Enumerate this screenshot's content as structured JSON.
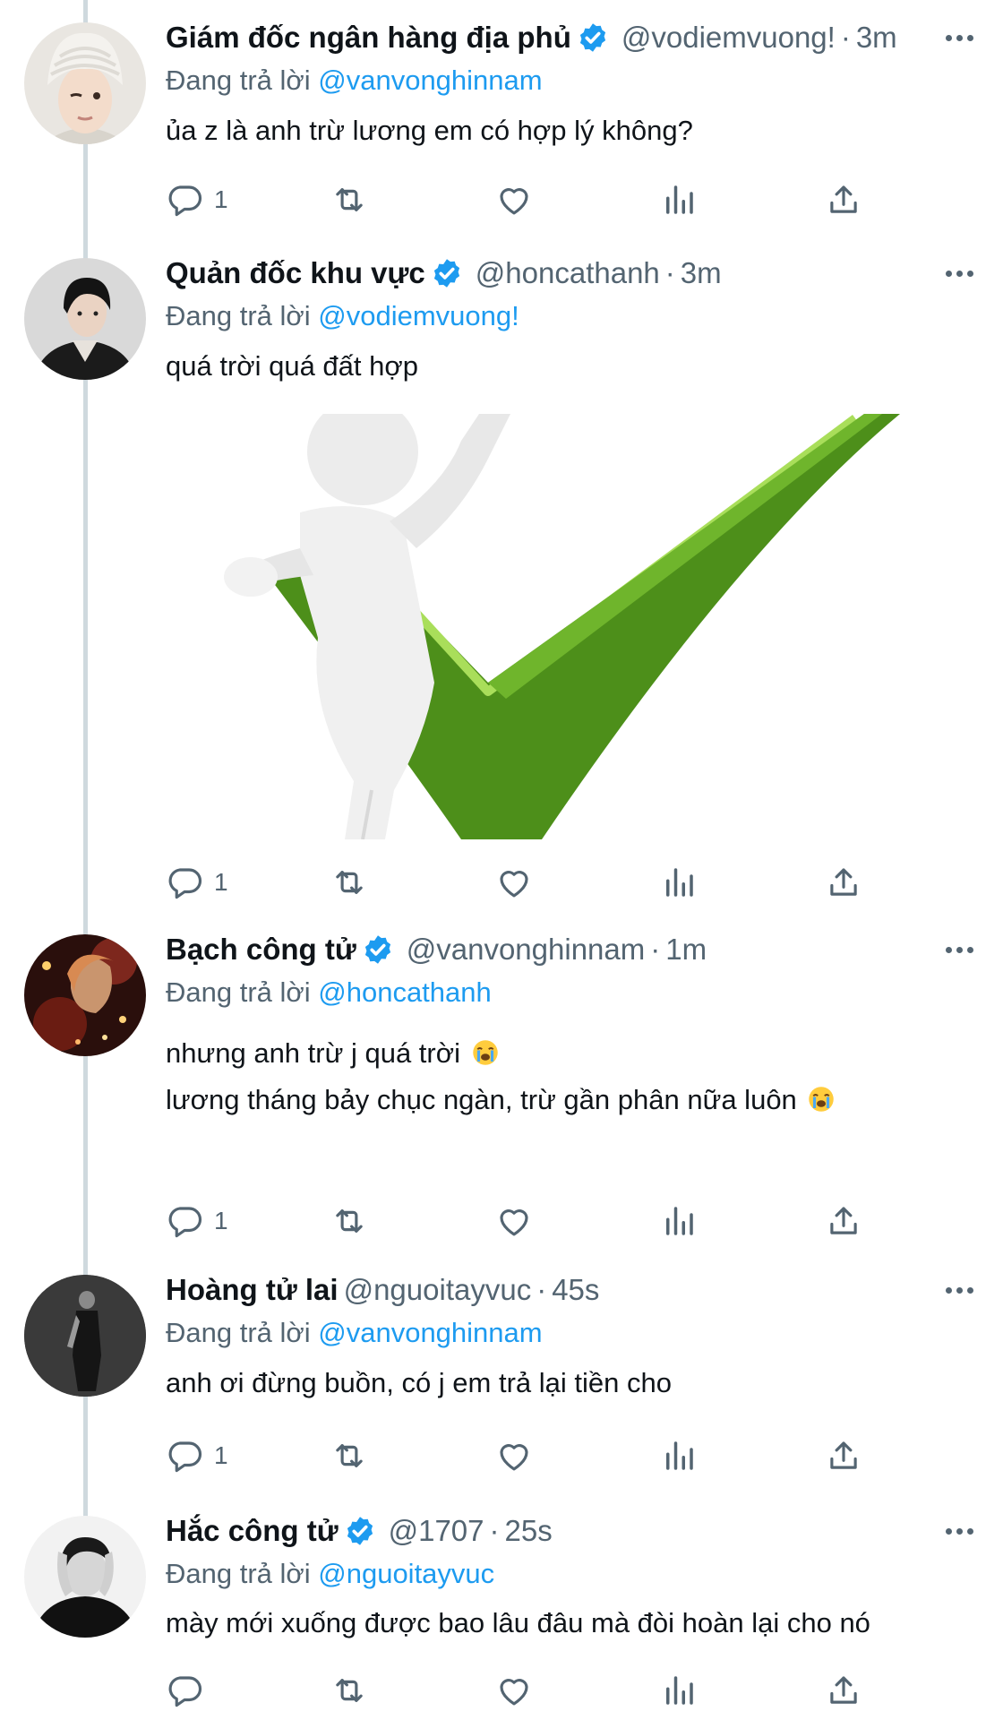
{
  "colors": {
    "accent": "#1d9bf0",
    "secondary_text": "#536471",
    "primary_text": "#0f1419",
    "thread_line": "#cfd9de"
  },
  "reply_prefix": "Đang trả lời",
  "tweets": [
    {
      "name": "Giám đốc ngân hàng địa phủ",
      "verified": true,
      "handle": "@vodiemvuong!",
      "time": "3m",
      "reply_to": "@vanvonghinnam",
      "lines": [
        "ủa z là anh trừ lương em có hợp lý không?"
      ],
      "reply_count": "1",
      "avatar_icon": "avatar-white-beanie"
    },
    {
      "name": "Quản đốc khu vực",
      "verified": true,
      "handle": "@honcathanh",
      "time": "3m",
      "reply_to": "@vodiemvuong!",
      "lines": [
        "quá trời quá đất hợp"
      ],
      "reply_count": "1",
      "media": "white-figure-pulling-green-checkmark",
      "avatar_icon": "avatar-dark-jacket"
    },
    {
      "name": "Bạch công tử",
      "verified": true,
      "handle": "@vanvonghinnam",
      "time": "1m",
      "reply_to": "@honcathanh",
      "lines": [
        "nhưng anh trừ j quá trời",
        "lương tháng bảy chục ngàn, trừ gần phân nữa luôn"
      ],
      "line_emoji": "loudly-crying-face-icon",
      "reply_count": "1",
      "avatar_icon": "avatar-red-lights"
    },
    {
      "name": "Hoàng tử lai",
      "verified": false,
      "handle": "@nguoitayvuc",
      "time": "45s",
      "reply_to": "@vanvonghinnam",
      "lines": [
        "anh ơi đừng buồn, có j em trả lại tiền cho"
      ],
      "reply_count": "1",
      "avatar_icon": "avatar-black-white-figure"
    },
    {
      "name": "Hắc công tử",
      "verified": true,
      "handle": "@1707",
      "time": "25s",
      "reply_to": "@nguoitayvuc",
      "lines": [
        "mày mới xuống được bao lâu đâu mà đòi hoàn lại cho nó"
      ],
      "reply_count": "",
      "avatar_icon": "avatar-black-white-hands"
    }
  ],
  "action_icons": [
    "reply-icon",
    "retweet-icon",
    "like-icon",
    "analytics-icon",
    "share-icon"
  ]
}
